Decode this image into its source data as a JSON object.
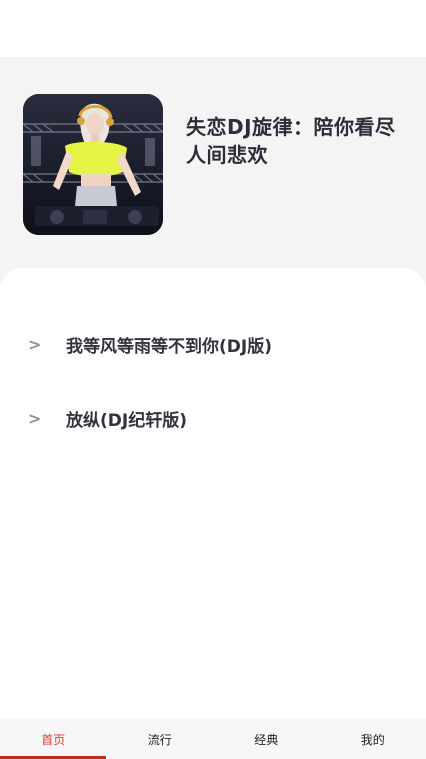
{
  "playlist": {
    "title": "失恋DJ旋律：陪你看尽人间悲欢",
    "cover_alt": "DJ performer album cover"
  },
  "songs": [
    {
      "chevron": ">",
      "title": "我等风等雨等不到你(DJ版)"
    },
    {
      "chevron": ">",
      "title": "放纵(DJ纪轩版)"
    }
  ],
  "tabs": [
    {
      "label": "首页",
      "active": true
    },
    {
      "label": "流行",
      "active": false
    },
    {
      "label": "经典",
      "active": false
    },
    {
      "label": "我的",
      "active": false
    }
  ],
  "colors": {
    "accent": "#c62a1f",
    "header_bg": "#f5f4f5",
    "title_text": "#2c2c3a"
  }
}
